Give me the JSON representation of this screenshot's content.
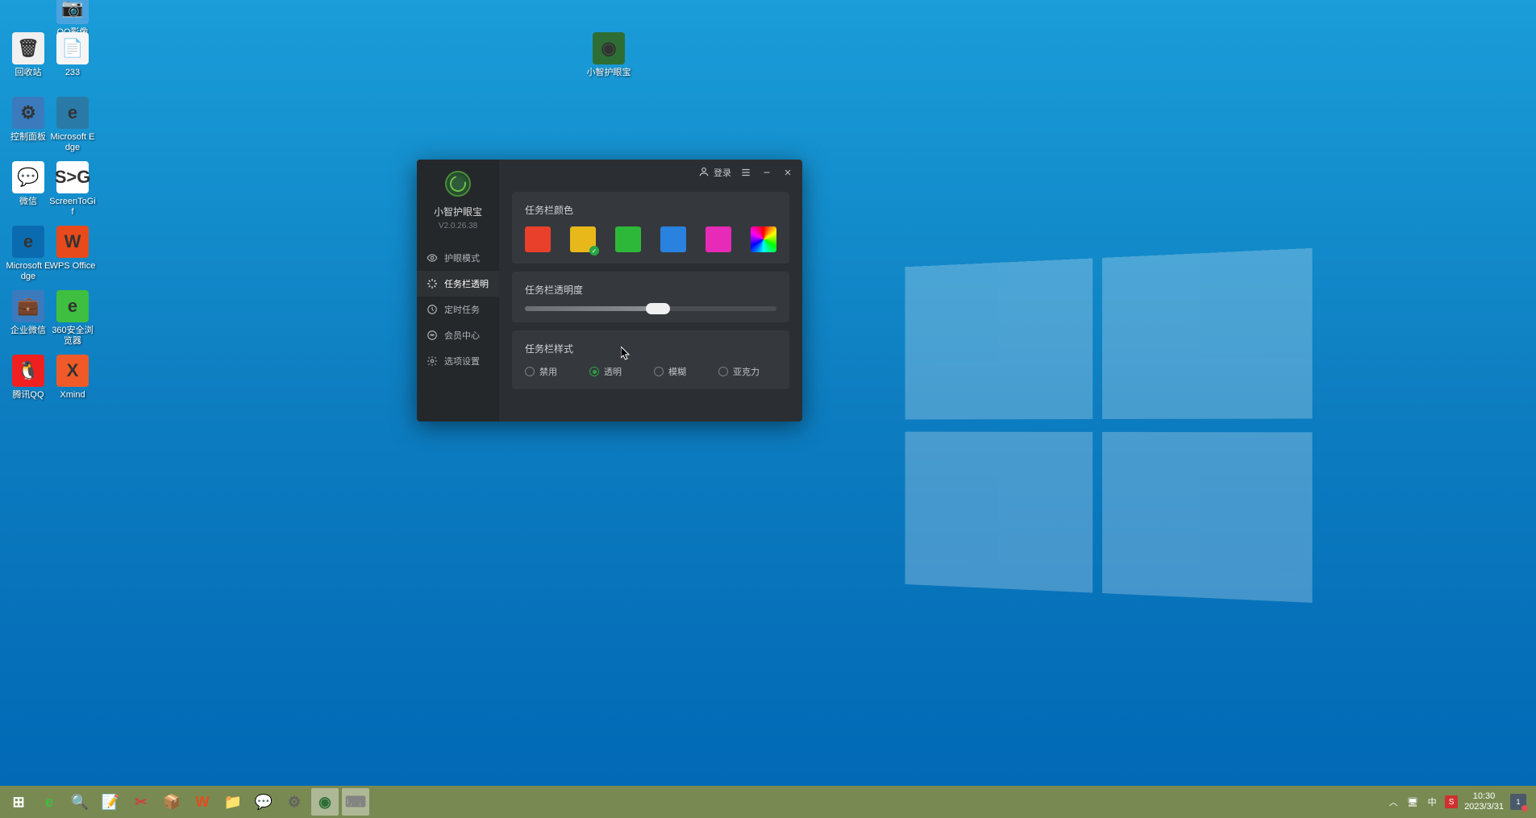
{
  "desktop_icons": [
    {
      "label": "QQ影像",
      "color": "#4aa3df",
      "glyph": "📷"
    },
    {
      "label": "回收站",
      "color": "#f0f0f0",
      "glyph": "🗑"
    },
    {
      "label": "233",
      "color": "#f5f5f5",
      "glyph": "📄"
    },
    {
      "label": "控制面板",
      "color": "#3a7abd",
      "glyph": "⚙"
    },
    {
      "label": "Microsoft Edge",
      "color": "#2a7aa8",
      "glyph": "e"
    },
    {
      "label": "微信",
      "color": "#ffffff",
      "glyph": "💬"
    },
    {
      "label": "ScreenToGif",
      "color": "#ffffff",
      "glyph": "S>G"
    },
    {
      "label": "Microsoft Edge",
      "color": "#0b6bb0",
      "glyph": "e"
    },
    {
      "label": "WPS Office",
      "color": "#e84a1c",
      "glyph": "W"
    },
    {
      "label": "企业微信",
      "color": "#3a7abd",
      "glyph": "💼"
    },
    {
      "label": "360安全浏览器",
      "color": "#3fbf3f",
      "glyph": "e"
    },
    {
      "label": "腾讯QQ",
      "color": "#f02020",
      "glyph": "🐧"
    },
    {
      "label": "Xmind",
      "color": "#f05a28",
      "glyph": "X"
    },
    {
      "label": "小智护眼宝",
      "color": "#2e6e35",
      "glyph": "◉"
    }
  ],
  "app": {
    "name": "小智护眼宝",
    "version": "V2.0.26.38",
    "login_label": "登录",
    "nav": [
      {
        "label": "护眼模式",
        "icon": "eye"
      },
      {
        "label": "任务栏透明",
        "icon": "sparkle",
        "active": true
      },
      {
        "label": "定时任务",
        "icon": "clock"
      },
      {
        "label": "会员中心",
        "icon": "crown"
      },
      {
        "label": "选项设置",
        "icon": "gear"
      }
    ],
    "card_color": {
      "title": "任务栏颜色",
      "swatches": [
        {
          "color": "#e8402a"
        },
        {
          "color": "#e8b81a",
          "selected": true
        },
        {
          "color": "#2eb83a"
        },
        {
          "color": "#2a82e0"
        },
        {
          "color": "#e82ab8"
        },
        {
          "rainbow": true
        }
      ]
    },
    "card_opacity": {
      "title": "任务栏透明度",
      "value": 53
    },
    "card_style": {
      "title": "任务栏样式",
      "options": [
        {
          "label": "禁用"
        },
        {
          "label": "透明",
          "selected": true
        },
        {
          "label": "模糊"
        },
        {
          "label": "亚克力"
        }
      ]
    }
  },
  "taskbar": {
    "items": [
      {
        "name": "start",
        "glyph": "⊞",
        "color": "#ffffff"
      },
      {
        "name": "browser360",
        "glyph": "e",
        "color": "#3fbf3f"
      },
      {
        "name": "search",
        "glyph": "🔍",
        "color": "#4aa3df"
      },
      {
        "name": "notes",
        "glyph": "📝",
        "color": "#d8b060"
      },
      {
        "name": "snip",
        "glyph": "✂",
        "color": "#d04040"
      },
      {
        "name": "filemanager",
        "glyph": "📦",
        "color": "#3a8ad0"
      },
      {
        "name": "wps",
        "glyph": "W",
        "color": "#e84a1c"
      },
      {
        "name": "explorer",
        "glyph": "📁",
        "color": "#f0c040"
      },
      {
        "name": "wechat",
        "glyph": "💬",
        "color": "#3fbf3f"
      },
      {
        "name": "settings",
        "glyph": "⚙",
        "color": "#606060"
      },
      {
        "name": "eyeapp",
        "glyph": "◉",
        "color": "#2e6e35",
        "active": true
      },
      {
        "name": "desk",
        "glyph": "⌨",
        "color": "#808080",
        "active": true
      }
    ],
    "tray": {
      "ime1": "中",
      "ime2": "S",
      "time": "10:30",
      "date": "2023/3/31",
      "notif_count": "1"
    }
  }
}
